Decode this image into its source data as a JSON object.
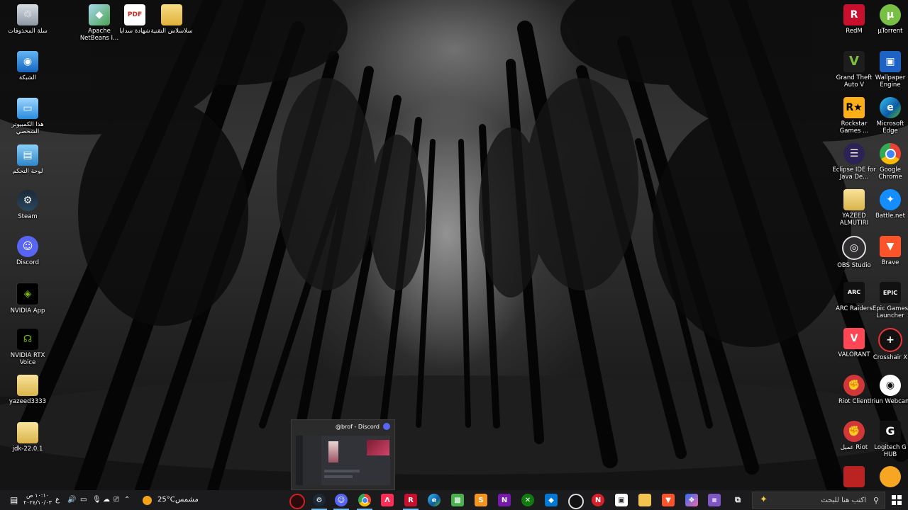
{
  "desktop": {
    "left_icons": [
      {
        "label": "سلة المحذوفات",
        "icon": "recycle-bin-icon"
      },
      {
        "label": "Apache NetBeans I...",
        "icon": "netbeans-icon"
      },
      {
        "label": "شهادة سدايا",
        "icon": "pdf-icon",
        "badge": "PDF"
      },
      {
        "label": "سلاسلاس التقنية",
        "icon": "folder-icon"
      },
      {
        "label": "الشبكة",
        "icon": "network-icon"
      },
      {
        "label": "هذا الكمبيوتر الشخصي",
        "icon": "computer-icon"
      },
      {
        "label": "لوحة التحكم",
        "icon": "control-panel-icon"
      },
      {
        "label": "Steam",
        "icon": "steam-icon"
      },
      {
        "label": "Discord",
        "icon": "discord-icon"
      },
      {
        "label": "NVIDIA App",
        "icon": "nvidia-icon"
      },
      {
        "label": "NVIDIA RTX Voice",
        "icon": "headset-icon"
      },
      {
        "label": "yazeed3333",
        "icon": "zip-folder-icon"
      },
      {
        "label": "jdk-22.0.1",
        "icon": "zip-folder-icon"
      }
    ],
    "right_icons": [
      {
        "label": "RedM",
        "icon": "redm-icon"
      },
      {
        "label": "µTorrent",
        "icon": "utorrent-icon"
      },
      {
        "label": "Grand Theft Auto V",
        "icon": "gta-icon"
      },
      {
        "label": "Wallpaper Engine",
        "icon": "wallpaper-engine-icon"
      },
      {
        "label": "Rockstar Games ...",
        "icon": "rockstar-icon"
      },
      {
        "label": "Microsoft Edge",
        "icon": "edge-icon"
      },
      {
        "label": "Eclipse IDE for Java De...",
        "icon": "eclipse-icon"
      },
      {
        "label": "Google Chrome",
        "icon": "chrome-icon"
      },
      {
        "label": "YAZEED ALMUTIRI",
        "icon": "folder-icon"
      },
      {
        "label": "Battle.net",
        "icon": "battlenet-icon"
      },
      {
        "label": "OBS Studio",
        "icon": "obs-icon"
      },
      {
        "label": "Brave",
        "icon": "brave-icon"
      },
      {
        "label": "ARC Raiders",
        "icon": "arc-raiders-icon"
      },
      {
        "label": "Epic Games Launcher",
        "icon": "epic-games-icon"
      },
      {
        "label": "VALORANT",
        "icon": "valorant-icon"
      },
      {
        "label": "Crosshair X",
        "icon": "crosshair-icon"
      },
      {
        "label": "Riot Client",
        "icon": "riot-icon"
      },
      {
        "label": "Iriun Webcam",
        "icon": "webcam-icon"
      },
      {
        "label": "عميل Riot",
        "icon": "riot-icon"
      },
      {
        "label": "Logitech G HUB",
        "icon": "logitech-icon"
      }
    ]
  },
  "preview": {
    "title": "@brof - Discord",
    "icon": "discord-icon"
  },
  "taskbar": {
    "search_placeholder": "اكتب هنا للبحث",
    "weather_temp": "25°C",
    "weather_text": "مشمس",
    "time": "١٠:١٠ ص",
    "date": "٢٠٢٤/١٠/٠٣",
    "language": "ع",
    "accent": "#76b9ed"
  }
}
